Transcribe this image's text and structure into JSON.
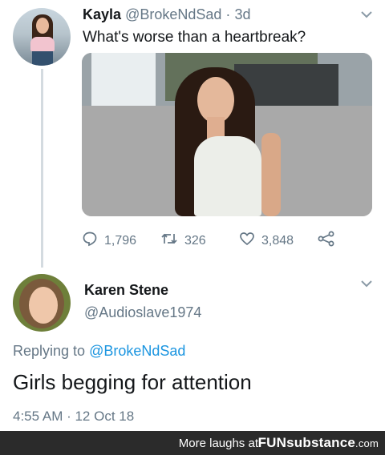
{
  "tweet": {
    "display_name": "Kayla",
    "handle": "@BrokeNdSad",
    "separator": "·",
    "age": "3d",
    "text": "What's worse than a heartbreak?",
    "actions": {
      "reply_count": "1,796",
      "retweet_count": "326",
      "like_count": "3,848"
    },
    "icons": [
      "reply-icon",
      "retweet-icon",
      "like-icon",
      "share-icon",
      "chevron-down-icon"
    ]
  },
  "reply": {
    "display_name": "Karen Stene",
    "handle": "@Audioslave1974",
    "replying_prefix": "Replying to",
    "replying_to": "@BrokeNdSad",
    "text": "Girls begging for attention",
    "timestamp": "4:55 AM · 12 Oct 18"
  },
  "footer": {
    "more_label": "More laughs at",
    "brand": "FUNsubstance",
    "brand_suffix": ".com"
  },
  "colors": {
    "link": "#1b95e0",
    "muted": "#657786",
    "footer_bg": "#2b2b2b"
  }
}
